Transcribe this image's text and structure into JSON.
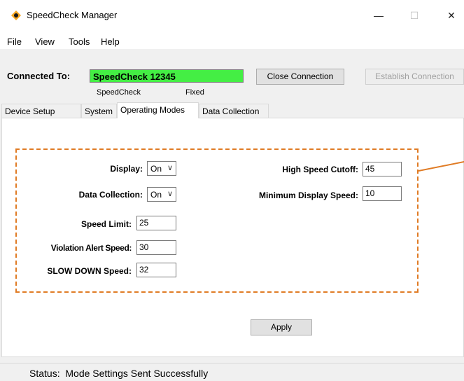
{
  "window": {
    "title": "SpeedCheck Manager",
    "controls": {
      "minimize": "—",
      "maximize": "☐",
      "close": "✕"
    }
  },
  "menu": [
    "File",
    "View",
    "Tools",
    "Help"
  ],
  "connection": {
    "label": "Connected To:",
    "device": "SpeedCheck 12345",
    "close_button": "Close Connection",
    "establish_button": "Establish Connection",
    "device_type": "SpeedCheck",
    "mount": "Fixed"
  },
  "tabs": [
    {
      "label": "Device Setup",
      "active": false
    },
    {
      "label": "System",
      "active": false
    },
    {
      "label": "Operating Modes",
      "active": true
    },
    {
      "label": "Data Collection",
      "active": false
    }
  ],
  "operating_modes": {
    "display": {
      "label": "Display:",
      "value": "On"
    },
    "data_collection": {
      "label": "Data Collection:",
      "value": "On"
    },
    "speed_limit": {
      "label": "Speed Limit:",
      "value": "25"
    },
    "violation_alert_speed": {
      "label": "Violation Alert Speed:",
      "value": "30"
    },
    "slow_down_speed": {
      "label": "SLOW DOWN Speed:",
      "value": "32"
    },
    "high_speed_cutoff": {
      "label": "High Speed Cutoff:",
      "value": "45"
    },
    "minimum_display_speed": {
      "label": "Minimum Display Speed:",
      "value": "10"
    }
  },
  "apply_button": "Apply",
  "status": {
    "label": "Status:",
    "text": "Mode Settings Sent Successfully"
  },
  "colors": {
    "accent_dashed": "#e07b24",
    "connected_bg": "#44ee44"
  },
  "icons": {
    "app": "speedcheck-app-icon",
    "dropdown": "chevron-down-icon"
  }
}
